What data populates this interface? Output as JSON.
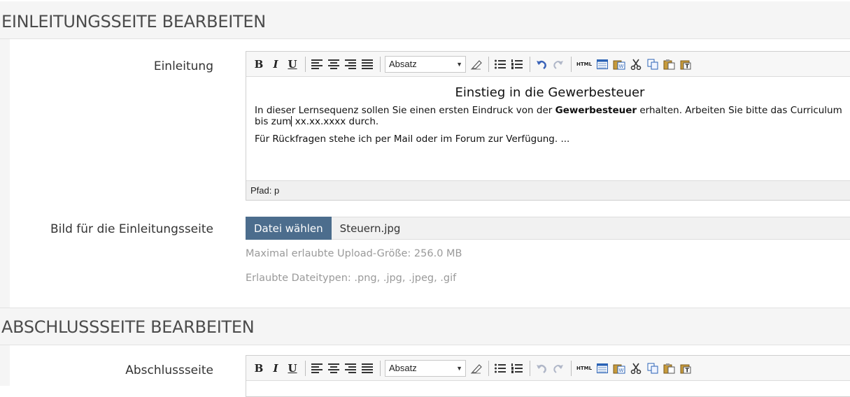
{
  "sections": [
    {
      "title": "EINLEITUNGSSEITE BEARBEITEN"
    },
    {
      "title": "ABSCHLUSSSEITE BEARBEITEN"
    }
  ],
  "intro": {
    "label": "Einleitung",
    "format_select": "Absatz",
    "heading": "Einstieg in die Gewerbesteuer",
    "para1_before": "In dieser Lernsequenz sollen Sie einen ersten Eindruck von der ",
    "para1_bold": "Gewerbesteuer",
    "para1_after": " erhalten. Arbeiten Sie bitte das Curriculum bis zum",
    "para1_end": " xx.xx.xxxx durch.",
    "para2": "Für Rückfragen stehe ich per Mail oder im Forum zur Verfügung. ...",
    "path": "Pfad: p"
  },
  "image": {
    "label": "Bild für die Einleitungsseite",
    "button": "Datei wählen",
    "filename": "Steuern.jpg",
    "max_size": "Maximal erlaubte Upload-Größe: 256.0 MB",
    "allowed_types": "Erlaubte Dateitypen: .png, .jpg, .jpeg, .gif"
  },
  "outro": {
    "label": "Abschlussseite",
    "format_select": "Absatz"
  },
  "toolbar": {
    "bold": "B",
    "italic": "I",
    "underline": "U",
    "html": "HTML",
    "icons": [
      "bold-icon",
      "italic-icon",
      "underline-icon",
      "align-left-icon",
      "align-center-icon",
      "align-right-icon",
      "align-justify-icon",
      "eraser-icon",
      "bullet-list-icon",
      "numbered-list-icon",
      "undo-icon",
      "redo-icon",
      "html-source-icon",
      "table-icon",
      "paste-word-icon",
      "cut-icon",
      "copy-icon",
      "paste-icon",
      "paste-text-icon"
    ]
  },
  "colors": {
    "accent": "#4c6d8d",
    "header_bg": "#f5f5f5",
    "help_text": "#9a9a9a"
  }
}
